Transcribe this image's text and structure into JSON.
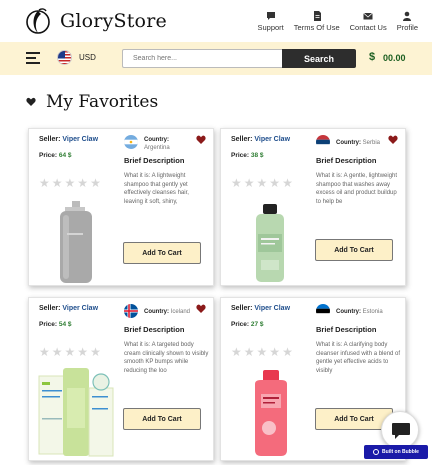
{
  "header": {
    "brand": "GloryStore",
    "nav": [
      {
        "label": "Support",
        "icon": "chat-icon"
      },
      {
        "label": "Terms Of Use",
        "icon": "document-icon"
      },
      {
        "label": "Contact Us",
        "icon": "envelope-icon"
      },
      {
        "label": "Profile",
        "icon": "user-icon"
      }
    ]
  },
  "subbar": {
    "currency": "USD",
    "search_placeholder": "Search here...",
    "search_label": "Search",
    "cart_symbol": "$",
    "cart_total": "00.00"
  },
  "page": {
    "title": "My Favorites"
  },
  "products": [
    {
      "seller_label": "Seller:",
      "seller": "Viper Claw",
      "price_label": "Price:",
      "price": "64 $",
      "country_label": "Country:",
      "country": "Argentina",
      "brief": "Brief Description",
      "desc": "What it is: A lightweight shampoo that gently yet effectively cleanses hair, leaving it soft, shiny,",
      "button": "Add To Cart",
      "rating": 0
    },
    {
      "seller_label": "Seller:",
      "seller": "Viper Claw",
      "price_label": "Price:",
      "price": "38 $",
      "country_label": "Country:",
      "country": "Serbia",
      "brief": "Brief Description",
      "desc": "What it is: A gentle, lightweight shampoo that washes away excess oil and product buildup to help be",
      "button": "Add To Cart",
      "rating": 0
    },
    {
      "seller_label": "Seller:",
      "seller": "Viper Claw",
      "price_label": "Price:",
      "price": "54 $",
      "country_label": "Country:",
      "country": "Iceland",
      "brief": "Brief Description",
      "desc": "What it is: A targeted body cream clinically shown to visibly smooth KP bumps while reducing the loo",
      "button": "Add To Cart",
      "rating": 0
    },
    {
      "seller_label": "Seller:",
      "seller": "Viper Claw",
      "price_label": "Price:",
      "price": "27 $",
      "country_label": "Country:",
      "country": "Estonia",
      "brief": "Brief Description",
      "desc": "What it is: A clarifying body cleanser infused with a blend of gentle yet effective acids to visibly",
      "button": "Add To Cart",
      "rating": 0
    }
  ],
  "badge": {
    "text": "Built on Bubble"
  },
  "colors": {
    "accent_bar": "#fdf3d3",
    "price_green": "#2e7d32",
    "seller_blue": "#1f4e8c",
    "heart_red": "#8b1a1a"
  }
}
